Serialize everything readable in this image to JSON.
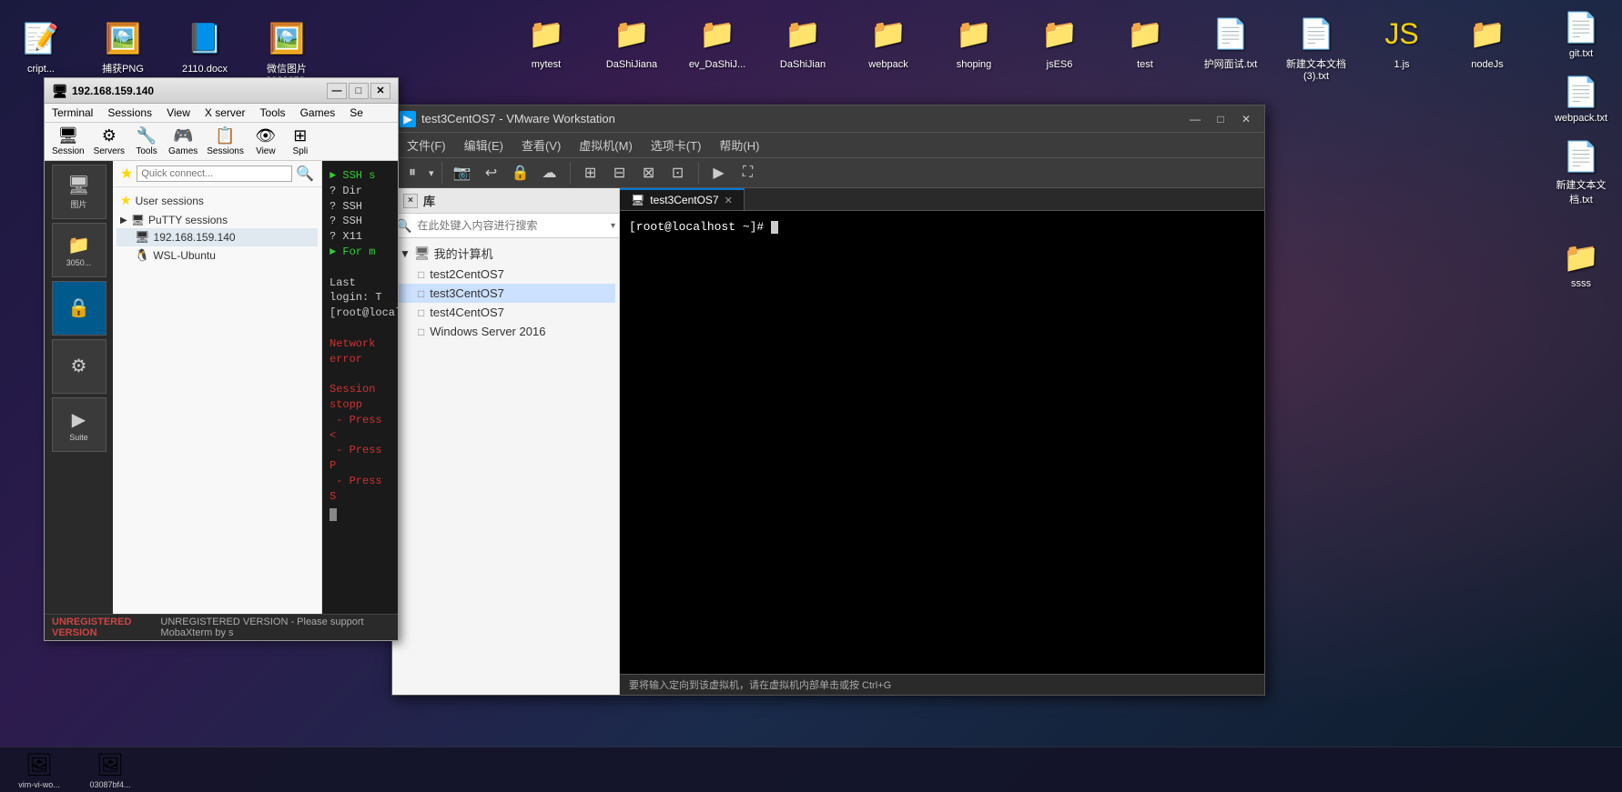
{
  "desktop": {
    "background_color": "#1a1a3e"
  },
  "top_icons": [
    {
      "id": "cript",
      "label": "cript...",
      "icon": "📝"
    },
    {
      "id": "png_capture",
      "label": "捕获PNG",
      "icon": "🖼️"
    },
    {
      "id": "docx_2110",
      "label": "2110.docx",
      "icon": "📘"
    },
    {
      "id": "wechat_img",
      "label": "微信图片_2023053...",
      "icon": "🖼️"
    },
    {
      "id": "mytest",
      "label": "mytest",
      "icon": "📁"
    },
    {
      "id": "dashijiana",
      "label": "DaShiJiana",
      "icon": "📁"
    },
    {
      "id": "ev_dashi",
      "label": "ev_DaShiJ...",
      "icon": "📁"
    },
    {
      "id": "dashijian",
      "label": "DaShiJian",
      "icon": "📁"
    },
    {
      "id": "webpack",
      "label": "webpack",
      "icon": "📁"
    },
    {
      "id": "shoping",
      "label": "shoping",
      "icon": "📁"
    },
    {
      "id": "jses6",
      "label": "jsES6",
      "icon": "📁"
    },
    {
      "id": "test",
      "label": "test",
      "icon": "📁"
    },
    {
      "id": "huwangmianshi",
      "label": "护网面试.txt",
      "icon": "📄"
    },
    {
      "id": "xinjiwen3",
      "label": "新建文本文档(3).txt",
      "icon": "📄"
    },
    {
      "id": "js1",
      "label": "1.js",
      "icon": "🟨"
    },
    {
      "id": "nodejs",
      "label": "nodeJs",
      "icon": "📁"
    }
  ],
  "right_icons": [
    {
      "id": "git_txt",
      "label": "git.txt",
      "icon": "📄"
    },
    {
      "id": "webpack_txt",
      "label": "webpack.txt",
      "icon": "📄"
    },
    {
      "id": "new_folder_txt",
      "label": "新建文本文档.txt",
      "icon": "📄"
    },
    {
      "id": "ssss_folder",
      "label": "ssss",
      "icon": "📁"
    }
  ],
  "mobaxterm": {
    "title": "192.168.159.140",
    "icon": "🖥",
    "menu_items": [
      "Terminal",
      "Sessions",
      "View",
      "X server",
      "Tools",
      "Games",
      "Se"
    ],
    "toolbar_items": [
      {
        "label": "Session",
        "icon": "🖥"
      },
      {
        "label": "Servers",
        "icon": "⚙"
      },
      {
        "label": "Tools",
        "icon": "🔧"
      },
      {
        "label": "Games",
        "icon": "🎮"
      },
      {
        "label": "Sessions",
        "icon": "📋"
      },
      {
        "label": "View",
        "icon": "👁"
      },
      {
        "label": "Spli",
        "icon": "⊞"
      }
    ],
    "quick_connect_placeholder": "Quick connect...",
    "sidebar": {
      "user_sessions_label": "User sessions",
      "putty_sessions_label": "PuTTY sessions",
      "items": [
        {
          "label": "192.168.159.140",
          "icon": "🖥",
          "active": true
        },
        {
          "label": "WSL-Ubuntu",
          "icon": "🐧"
        }
      ]
    },
    "terminal_lines": [
      {
        "text": "► SSH s",
        "color": "green"
      },
      {
        "text": "? Dir",
        "color": "white"
      },
      {
        "text": "? SSH",
        "color": "white"
      },
      {
        "text": "? SSH",
        "color": "white"
      },
      {
        "text": "? X11",
        "color": "white"
      },
      {
        "text": "► For m",
        "color": "green"
      },
      {
        "text": "",
        "color": "white"
      },
      {
        "text": "Last login: T",
        "color": "white"
      },
      {
        "text": "[root@localho",
        "color": "white"
      },
      {
        "text": "",
        "color": "white"
      },
      {
        "text": "Network error",
        "color": "red"
      },
      {
        "text": "",
        "color": "white"
      },
      {
        "text": "Session stopp",
        "color": "red"
      },
      {
        "text": " - Press <",
        "color": "red"
      },
      {
        "text": " - Press P",
        "color": "red"
      },
      {
        "text": " - Press S",
        "color": "red"
      }
    ],
    "statusbar": "UNREGISTERED VERSION  -  Please support MobaXterm by s",
    "taskbar_items": [
      {
        "label": "vim-vi-wo...",
        "icon": "🖼"
      },
      {
        "label": "03087bf4...",
        "icon": "🖼"
      }
    ]
  },
  "vmware": {
    "title": "test3CentOS7 - VMware Workstation",
    "icon": "▶",
    "menu_items": [
      {
        "label": "文件(F)"
      },
      {
        "label": "编辑(E)"
      },
      {
        "label": "查看(V)"
      },
      {
        "label": "虚拟机(M)"
      },
      {
        "label": "选项卡(T)"
      },
      {
        "label": "帮助(H)"
      }
    ],
    "toolbar_buttons": [
      {
        "icon": "⏸",
        "label": "pause"
      },
      {
        "icon": "⬇",
        "label": "down"
      },
      {
        "icon": "↩",
        "label": "revert"
      },
      {
        "icon": "🔒",
        "label": "lock"
      },
      {
        "icon": "☁",
        "label": "cloud"
      },
      {
        "icon": "⊞",
        "label": "fullscreen"
      },
      {
        "icon": "⊟",
        "label": "minimize"
      },
      {
        "icon": "⊠",
        "label": "fit"
      },
      {
        "icon": "⊡",
        "label": "stretch"
      },
      {
        "icon": "▶",
        "label": "console"
      },
      {
        "icon": "⛶",
        "label": "unity"
      }
    ],
    "library_panel": {
      "header": "库",
      "search_placeholder": "在此处键入内容进行搜索",
      "close_btn": "×",
      "tree": {
        "root": "我的计算机",
        "items": [
          {
            "label": "test2CentOS7",
            "selected": false
          },
          {
            "label": "test3CentOS7",
            "selected": true
          },
          {
            "label": "test4CentOS7",
            "selected": false
          },
          {
            "label": "Windows Server 2016",
            "selected": false
          }
        ]
      }
    },
    "tabs": [
      {
        "label": "test3CentOS7",
        "active": true,
        "closable": true
      }
    ],
    "terminal": {
      "prompt": "[root@localhost ~]#",
      "cursor": "█"
    },
    "statusbar": "要将输入定向到该虚拟机，请在虚拟机内部单击或按 Ctrl+G"
  }
}
